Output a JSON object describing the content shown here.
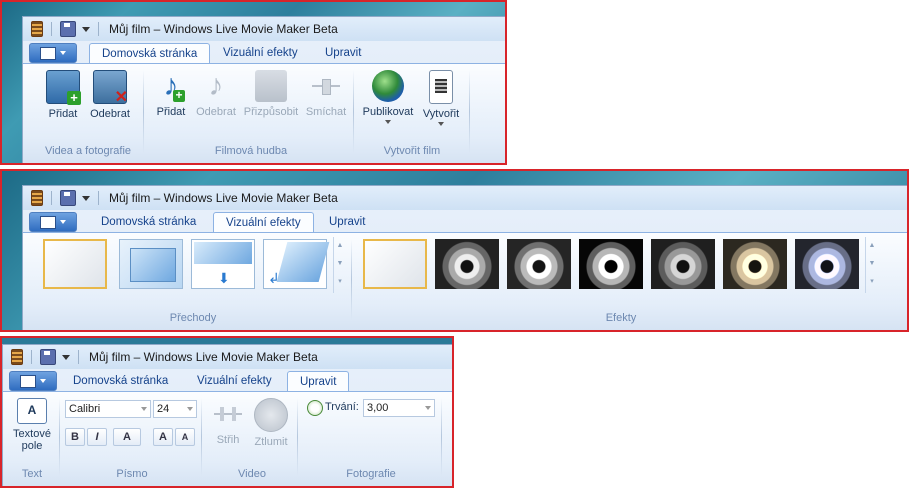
{
  "window": {
    "title": "Můj film – Windows Live Movie Maker Beta"
  },
  "tabs": [
    "Domovská stránka",
    "Vizuální efekty",
    "Upravit"
  ],
  "home": {
    "buttons": {
      "add": "Přidat",
      "remove": "Odebrat",
      "music_add": "Přidat",
      "music_remove": "Odebrat",
      "fit": "Přizpůsobit",
      "mix": "Smíchat",
      "publish": "Publikovat",
      "create": "Vytvořit"
    },
    "groups": {
      "videos": "Videa a fotografie",
      "music": "Filmová hudba",
      "create": "Vytvořit film"
    }
  },
  "effects": {
    "groups": {
      "transitions": "Přechody",
      "effects": "Efekty"
    }
  },
  "edit": {
    "buttons": {
      "textbox_line1": "Textové",
      "textbox_line2": "pole",
      "trim": "Střih",
      "mute": "Ztlumit"
    },
    "font": {
      "family": "Calibri",
      "size": "24",
      "bold": "B",
      "italic": "I",
      "color": "A",
      "grow": "A",
      "shrink": "A"
    },
    "duration": {
      "label": "Trvání:",
      "value": "3,00"
    },
    "groups": {
      "text": "Text",
      "font": "Písmo",
      "video": "Video",
      "photos": "Fotografie"
    }
  },
  "colors": {
    "accent": "#15428b",
    "frame": "#d8242a"
  }
}
